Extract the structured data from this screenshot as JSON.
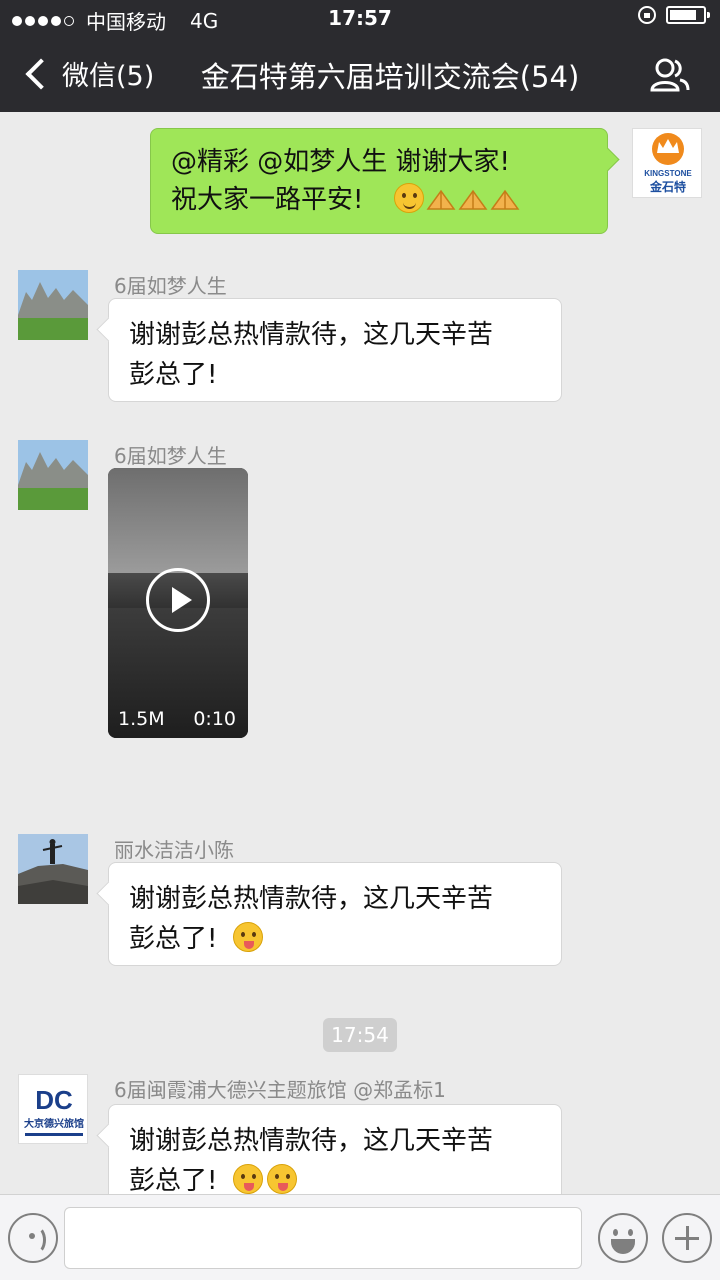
{
  "status_bar": {
    "carrier": "中国移动",
    "network": "4G",
    "time": "17:57"
  },
  "nav": {
    "back_label": "微信(5)",
    "title": "金石特第六届培训交流会(54)"
  },
  "messages": [
    {
      "from_self": true,
      "line1": "@精彩 @如梦人生 谢谢大家!",
      "line2": "祝大家一路平安!",
      "avatar_text_top": "KINGSTONE",
      "avatar_text_bottom": "金石特"
    },
    {
      "sender": "6届如梦人生",
      "line1": "谢谢彭总热情款待，这几天辛苦",
      "line2": "彭总了!"
    },
    {
      "sender": "6届如梦人生",
      "video_size": "1.5M",
      "video_duration": "0:10"
    },
    {
      "sender": "丽水洁洁小陈",
      "line1": "谢谢彭总热情款待，这几天辛苦",
      "line2": "彭总了!"
    },
    {
      "sender": "6届闽霞浦大德兴主题旅馆 @郑孟标1",
      "line1": "谢谢彭总热情款待，这几天辛苦",
      "line2": "彭总了!",
      "avatar_text": "大京德兴旅馆"
    }
  ],
  "timestamp": "17:54",
  "colors": {
    "nav_bg": "#2b2b2f",
    "self_bubble": "#9fe658",
    "chat_bg": "#ebebeb"
  }
}
